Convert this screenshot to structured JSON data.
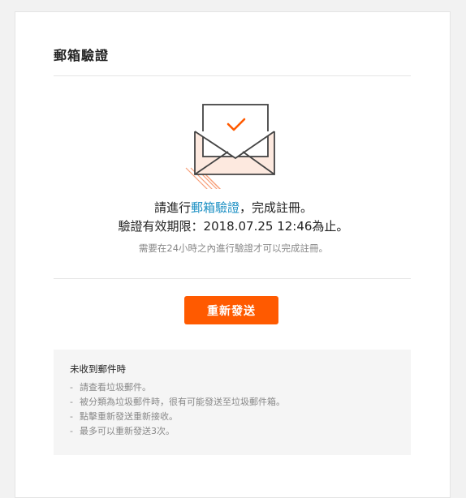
{
  "page": {
    "title": "郵箱驗證"
  },
  "message": {
    "line1_prefix": "請進行",
    "line1_link": "郵箱驗證",
    "line1_suffix": "，完成註冊。",
    "line2": "驗證有效期限：2018.07.25 12:46為止。",
    "hint": "需要在24小時之內進行驗證才可以完成註冊。"
  },
  "actions": {
    "resend_label": "重新發送"
  },
  "help": {
    "title": "未收到郵件時",
    "items": [
      "請查看垃圾郵件。",
      "被分類為垃圾郵件時，很有可能發送至垃圾郵件箱。",
      "點擊重新發送重新接收。",
      "最多可以重新發送3次。"
    ]
  },
  "colors": {
    "accent": "#ff5a00",
    "link": "#1a8fc3",
    "check": "#ff5a00"
  },
  "icons": {
    "illustration": "envelope-check-icon"
  }
}
